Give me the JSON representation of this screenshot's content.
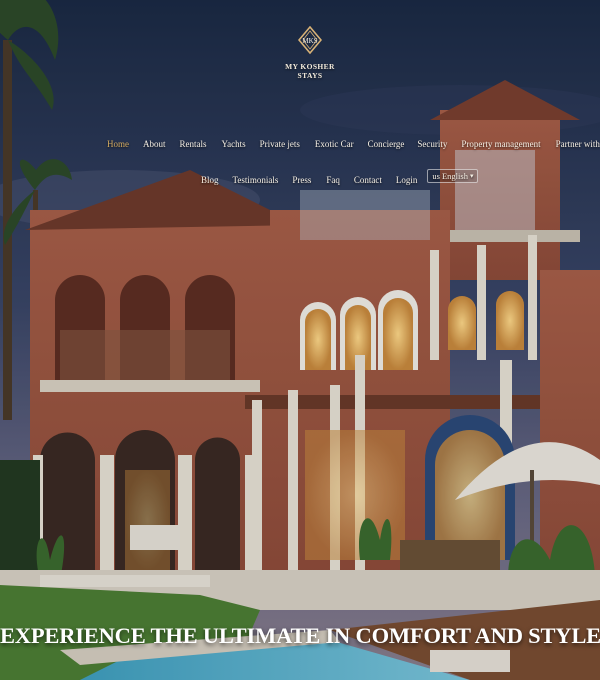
{
  "brand": {
    "monogram": "MKS",
    "name": "MY KOSHER\nSTAYS"
  },
  "nav": {
    "row1": [
      "Home",
      "About",
      "Rentals",
      "Yachts",
      "Private jets",
      "Exotic Car",
      "Concierge",
      "Security",
      "Property management",
      "Partner with us"
    ],
    "row2": [
      "Blog",
      "Testimonials",
      "Press",
      "Faq",
      "Contact",
      "Login"
    ],
    "active": "Home"
  },
  "language": {
    "code": "us",
    "label": "English"
  },
  "hero": {
    "headline": "EXPERIENCE THE ULTIMATE IN COMFORT AND STYLE"
  },
  "colors": {
    "active_link": "#d2a960",
    "nav_text": "#f5efe4",
    "sky_top": "#1b2a45",
    "villa_wall": "#a65a44"
  }
}
